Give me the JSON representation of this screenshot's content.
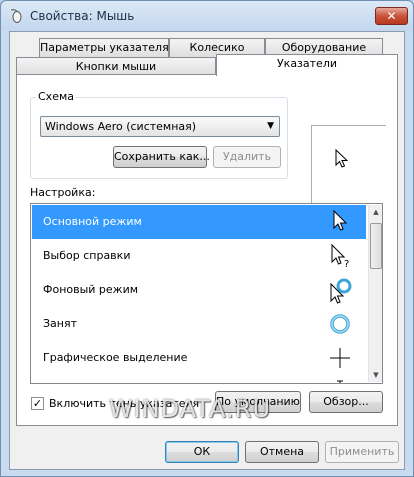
{
  "window": {
    "title": "Свойства: Мышь",
    "close_label": "✕"
  },
  "tabs": {
    "row1": [
      "Параметры указателя",
      "Колесико",
      "Оборудование"
    ],
    "row2": [
      "Кнопки мыши",
      "Указатели"
    ],
    "active": "Указатели"
  },
  "scheme": {
    "group_label": "Схема",
    "selected": "Windows Aero (системная)",
    "save_label": "Сохранить как...",
    "delete_label": "Удалить"
  },
  "customize": {
    "label": "Настройка:",
    "items": [
      {
        "label": "Основной режим",
        "cursor": "arrow-cursor-icon",
        "selected": true
      },
      {
        "label": "Выбор справки",
        "cursor": "help-cursor-icon",
        "selected": false
      },
      {
        "label": "Фоновый режим",
        "cursor": "working-in-background-cursor-icon",
        "selected": false
      },
      {
        "label": "Занят",
        "cursor": "busy-cursor-icon",
        "selected": false
      },
      {
        "label": "Графическое выделение",
        "cursor": "precision-select-cursor-icon",
        "selected": false
      }
    ]
  },
  "shadow": {
    "label": "Включить тень указателя",
    "checked": true
  },
  "buttons": {
    "default_label": "По умолчанию",
    "browse_label": "Обзор...",
    "ok_label": "ОК",
    "cancel_label": "Отмена",
    "apply_label": "Применить"
  },
  "watermark": "WINDATA.RU",
  "colors": {
    "selection": "#3399ff",
    "window_frame": "#c9dbef"
  }
}
